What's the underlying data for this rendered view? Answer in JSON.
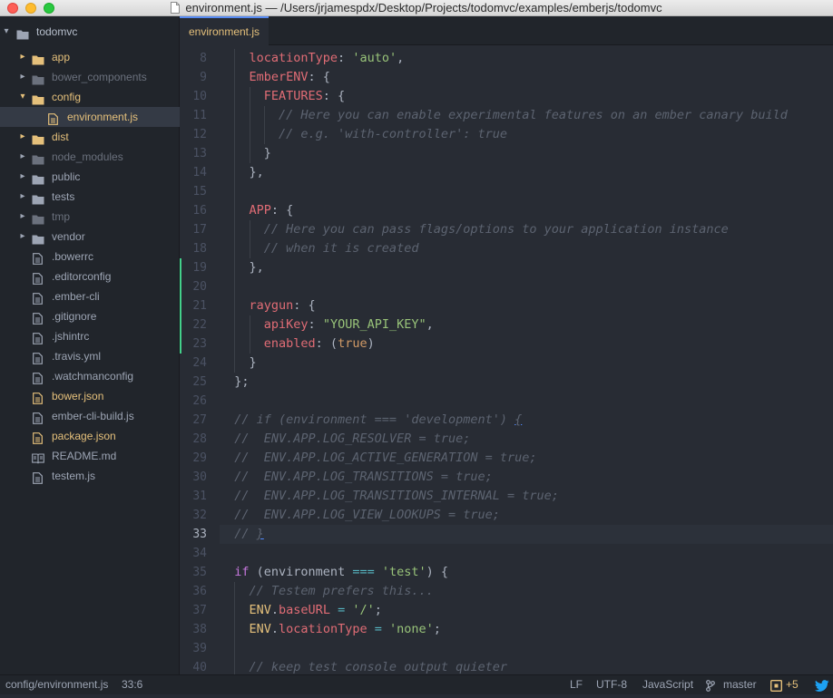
{
  "window": {
    "title": "environment.js — /Users/jrjamespdx/Desktop/Projects/todomvc/examples/emberjs/todomvc"
  },
  "tree": {
    "root": "todomvc",
    "items": [
      {
        "label": "app",
        "kind": "folder",
        "expanded": false,
        "status": "modified"
      },
      {
        "label": "bower_components",
        "kind": "folder",
        "expanded": false,
        "status": "ignored"
      },
      {
        "label": "config",
        "kind": "folder",
        "expanded": true,
        "status": "modified"
      },
      {
        "label": "environment.js",
        "kind": "file",
        "status": "modified",
        "selected": true
      },
      {
        "label": "dist",
        "kind": "folder",
        "expanded": false,
        "status": "modified"
      },
      {
        "label": "node_modules",
        "kind": "folder",
        "expanded": false,
        "status": "ignored"
      },
      {
        "label": "public",
        "kind": "folder",
        "expanded": false,
        "status": "normal"
      },
      {
        "label": "tests",
        "kind": "folder",
        "expanded": false,
        "status": "normal"
      },
      {
        "label": "tmp",
        "kind": "folder",
        "expanded": false,
        "status": "ignored"
      },
      {
        "label": "vendor",
        "kind": "folder",
        "expanded": false,
        "status": "normal"
      },
      {
        "label": ".bowerrc",
        "kind": "file",
        "status": "normal"
      },
      {
        "label": ".editorconfig",
        "kind": "file",
        "status": "normal"
      },
      {
        "label": ".ember-cli",
        "kind": "file",
        "status": "normal"
      },
      {
        "label": ".gitignore",
        "kind": "file",
        "status": "normal"
      },
      {
        "label": ".jshintrc",
        "kind": "file",
        "status": "normal"
      },
      {
        "label": ".travis.yml",
        "kind": "file",
        "status": "normal"
      },
      {
        "label": ".watchmanconfig",
        "kind": "file",
        "status": "normal"
      },
      {
        "label": "bower.json",
        "kind": "file",
        "status": "modified"
      },
      {
        "label": "ember-cli-build.js",
        "kind": "file",
        "status": "normal"
      },
      {
        "label": "package.json",
        "kind": "file",
        "status": "modified"
      },
      {
        "label": "README.md",
        "kind": "book",
        "status": "normal"
      },
      {
        "label": "testem.js",
        "kind": "file",
        "status": "normal"
      }
    ]
  },
  "tabs": [
    {
      "label": "environment.js",
      "active": true
    }
  ],
  "editor": {
    "current_line": 33,
    "git_added_lines": [
      19,
      20,
      21,
      22,
      23
    ],
    "lines": [
      {
        "n": 8,
        "t": [
          [
            "    locationType",
            "p"
          ],
          [
            ": ",
            ""
          ],
          [
            "'auto'",
            "s"
          ],
          [
            ",",
            ""
          ]
        ]
      },
      {
        "n": 9,
        "t": [
          [
            "    EmberENV",
            "p"
          ],
          [
            ": {",
            ""
          ]
        ]
      },
      {
        "n": 10,
        "t": [
          [
            "      FEATURES",
            "p"
          ],
          [
            ": {",
            ""
          ]
        ]
      },
      {
        "n": 11,
        "t": [
          [
            "        // Here you can enable experimental features on an ember canary build",
            "c"
          ]
        ]
      },
      {
        "n": 12,
        "t": [
          [
            "        // e.g. 'with-controller': true",
            "c"
          ]
        ]
      },
      {
        "n": 13,
        "t": [
          [
            "      }",
            ""
          ]
        ]
      },
      {
        "n": 14,
        "t": [
          [
            "    },",
            ""
          ]
        ]
      },
      {
        "n": 15,
        "t": []
      },
      {
        "n": 16,
        "t": [
          [
            "    APP",
            "p"
          ],
          [
            ": {",
            ""
          ]
        ]
      },
      {
        "n": 17,
        "t": [
          [
            "      // Here you can pass flags/options to your application instance",
            "c"
          ]
        ]
      },
      {
        "n": 18,
        "t": [
          [
            "      // when it is created",
            "c"
          ]
        ]
      },
      {
        "n": 19,
        "t": [
          [
            "    },",
            ""
          ]
        ]
      },
      {
        "n": 20,
        "t": []
      },
      {
        "n": 21,
        "t": [
          [
            "    raygun",
            "p"
          ],
          [
            ": {",
            ""
          ]
        ]
      },
      {
        "n": 22,
        "t": [
          [
            "      apiKey",
            "p"
          ],
          [
            ": ",
            ""
          ],
          [
            "\"YOUR_API_KEY\"",
            "s"
          ],
          [
            ",",
            ""
          ]
        ]
      },
      {
        "n": 23,
        "t": [
          [
            "      enabled",
            "p"
          ],
          [
            ": (",
            ""
          ],
          [
            "true",
            "n"
          ],
          [
            ")",
            ""
          ]
        ]
      },
      {
        "n": 24,
        "t": [
          [
            "    }",
            ""
          ]
        ]
      },
      {
        "n": 25,
        "t": [
          [
            "  };",
            ""
          ]
        ]
      },
      {
        "n": 26,
        "t": []
      },
      {
        "n": 27,
        "t": [
          [
            "  // if (environment === 'development') ",
            "c"
          ],
          [
            "{",
            "cu"
          ]
        ]
      },
      {
        "n": 28,
        "t": [
          [
            "  //  ENV.APP.LOG_RESOLVER = true;",
            "c"
          ]
        ]
      },
      {
        "n": 29,
        "t": [
          [
            "  //  ENV.APP.LOG_ACTIVE_GENERATION = true;",
            "c"
          ]
        ]
      },
      {
        "n": 30,
        "t": [
          [
            "  //  ENV.APP.LOG_TRANSITIONS = true;",
            "c"
          ]
        ]
      },
      {
        "n": 31,
        "t": [
          [
            "  //  ENV.APP.LOG_TRANSITIONS_INTERNAL = true;",
            "c"
          ]
        ]
      },
      {
        "n": 32,
        "t": [
          [
            "  //  ENV.APP.LOG_VIEW_LOOKUPS = true;",
            "c"
          ]
        ]
      },
      {
        "n": 33,
        "t": [
          [
            "  // ",
            "c"
          ],
          [
            "}",
            "cu"
          ]
        ]
      },
      {
        "n": 34,
        "t": []
      },
      {
        "n": 35,
        "t": [
          [
            "  ",
            ""
          ],
          [
            "if",
            "k"
          ],
          [
            " (environment ",
            ""
          ],
          [
            "===",
            "o"
          ],
          [
            " ",
            ""
          ],
          [
            "'test'",
            "s"
          ],
          [
            ") {",
            ""
          ]
        ]
      },
      {
        "n": 36,
        "t": [
          [
            "    // Testem prefers this...",
            "c"
          ]
        ]
      },
      {
        "n": 37,
        "t": [
          [
            "    ENV",
            "y"
          ],
          [
            ".",
            ""
          ],
          [
            "baseURL",
            "p"
          ],
          [
            " ",
            ""
          ],
          [
            "=",
            "o"
          ],
          [
            " ",
            ""
          ],
          [
            "'/'",
            "s"
          ],
          [
            ";",
            ""
          ]
        ]
      },
      {
        "n": 38,
        "t": [
          [
            "    ENV",
            "y"
          ],
          [
            ".",
            ""
          ],
          [
            "locationType",
            "p"
          ],
          [
            " ",
            ""
          ],
          [
            "=",
            "o"
          ],
          [
            " ",
            ""
          ],
          [
            "'none'",
            "s"
          ],
          [
            ";",
            ""
          ]
        ]
      },
      {
        "n": 39,
        "t": []
      },
      {
        "n": 40,
        "t": [
          [
            "    // keep test console output quieter",
            "c"
          ]
        ]
      }
    ]
  },
  "status": {
    "file_path": "config/environment.js",
    "cursor": "33:6",
    "line_ending": "LF",
    "encoding": "UTF-8",
    "grammar": "JavaScript",
    "branch": "master",
    "changes": "+5"
  }
}
